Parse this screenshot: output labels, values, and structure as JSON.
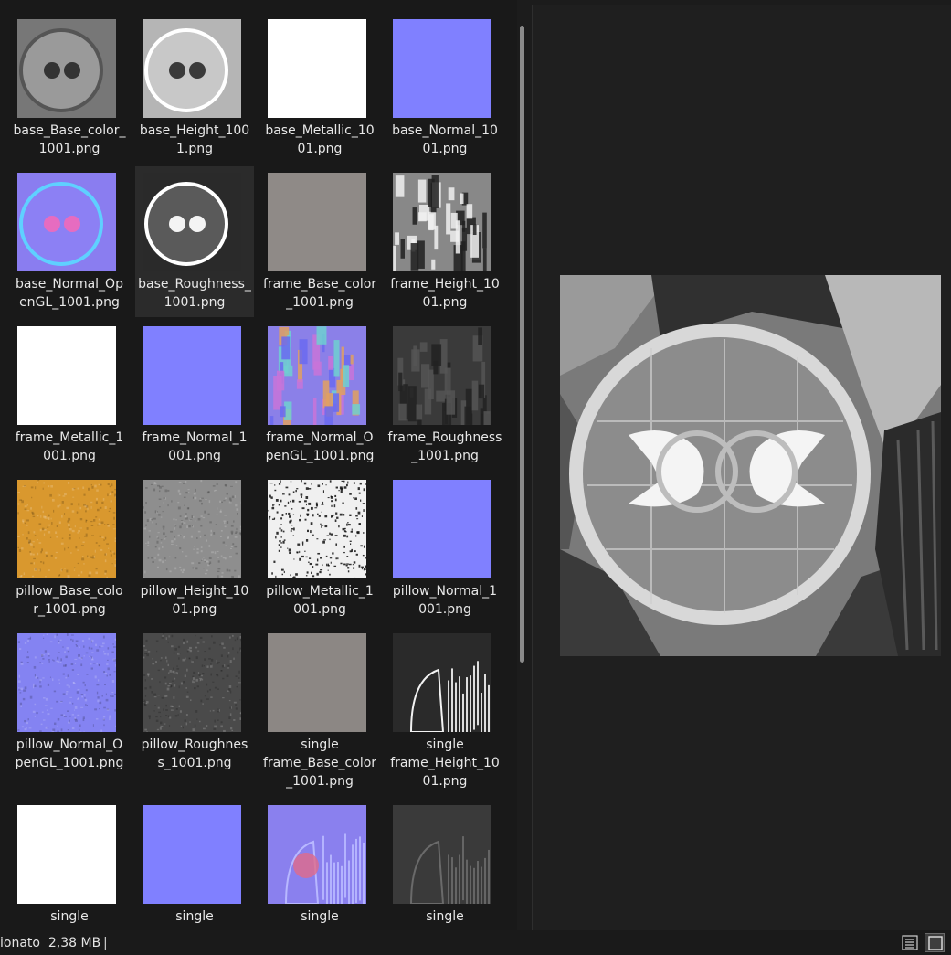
{
  "files": [
    {
      "name": "base_Base_color_\n1001.png",
      "thumb": "gray-sphere",
      "color": "#777777"
    },
    {
      "name": "base_Height_100\n1.png",
      "thumb": "height-sphere",
      "color": "#b5b5b5"
    },
    {
      "name": "base_Metallic_10\n01.png",
      "thumb": "solid",
      "color": "#ffffff"
    },
    {
      "name": "base_Normal_10\n01.png",
      "thumb": "solid",
      "color": "#8080ff"
    },
    {
      "name": "base_Normal_Op\nenGL_1001.png",
      "thumb": "normal-sphere",
      "color": "#8a7df0"
    },
    {
      "name": "base_Roughness_\n1001.png",
      "thumb": "dark-sphere",
      "color": "#8a8a8a",
      "selected": true
    },
    {
      "name": "frame_Base_color\n_1001.png",
      "thumb": "solid",
      "color": "#8f8a87"
    },
    {
      "name": "frame_Height_10\n01.png",
      "thumb": "stripes",
      "color": "#888888"
    },
    {
      "name": "frame_Metallic_1\n001.png",
      "thumb": "solid",
      "color": "#ffffff"
    },
    {
      "name": "frame_Normal_1\n001.png",
      "thumb": "solid",
      "color": "#8080ff"
    },
    {
      "name": "frame_Normal_O\npenGL_1001.png",
      "thumb": "normal-noise",
      "color": "#8b80e8"
    },
    {
      "name": "frame_Roughness\n_1001.png",
      "thumb": "dark-stripes",
      "color": "#3a3a3a"
    },
    {
      "name": "pillow_Base_colo\nr_1001.png",
      "thumb": "noise",
      "color": "#d9982e"
    },
    {
      "name": "pillow_Height_10\n01.png",
      "thumb": "noise",
      "color": "#8e8e8e"
    },
    {
      "name": "pillow_Metallic_1\n001.png",
      "thumb": "speckle",
      "color": "#f0f0f0"
    },
    {
      "name": "pillow_Normal_1\n001.png",
      "thumb": "solid",
      "color": "#8080ff"
    },
    {
      "name": "pillow_Normal_O\npenGL_1001.png",
      "thumb": "noise",
      "color": "#8483f2"
    },
    {
      "name": "pillow_Roughnes\ns_1001.png",
      "thumb": "noise",
      "color": "#4a4a4a"
    },
    {
      "name": "single\nframe_Base_color\n_1001.png",
      "thumb": "solid",
      "color": "#8c8784"
    },
    {
      "name": "single\nframe_Height_10\n01.png",
      "thumb": "arch",
      "color": "#2a2a2a"
    },
    {
      "name": "single",
      "thumb": "solid",
      "color": "#ffffff"
    },
    {
      "name": "single",
      "thumb": "solid",
      "color": "#8080ff"
    },
    {
      "name": "single",
      "thumb": "normal-arch",
      "color": "#8a80ee"
    },
    {
      "name": "single",
      "thumb": "dark-arch",
      "color": "#3a3a3a"
    }
  ],
  "status": {
    "text": "ionato  2,38 MB",
    "separator": "|"
  },
  "view_buttons": {
    "details": "details-view-icon",
    "large_icons": "large-icons-view-icon"
  }
}
